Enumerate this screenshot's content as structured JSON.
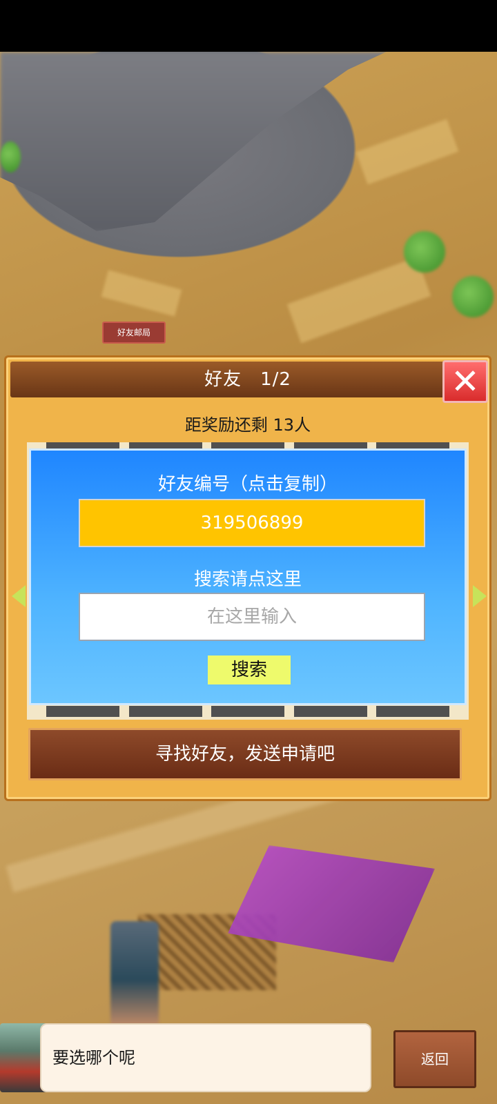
{
  "map": {
    "post_office_label": "好友邮局"
  },
  "dialog": {
    "title": "好友　1/2",
    "reward_text": "距奖励还剩 13人",
    "friend_id_label": "好友编号（点击复制）",
    "friend_id": "319506899",
    "search_label": "搜索请点这里",
    "search_placeholder": "在这里输入",
    "search_button": "搜索",
    "find_button": "寻找好友，发送申请吧"
  },
  "bottom": {
    "speech": "要选哪个呢",
    "back_button": "返回"
  },
  "colors": {
    "friend_id_bg": "#ffc400",
    "panel_blue": "#1f86ff",
    "close_red": "#d92c2c",
    "search_button_bg": "#eefa6c"
  },
  "icons": {
    "close": "close-icon",
    "left_arrow": "arrow-left-icon",
    "right_arrow": "arrow-right-icon"
  }
}
